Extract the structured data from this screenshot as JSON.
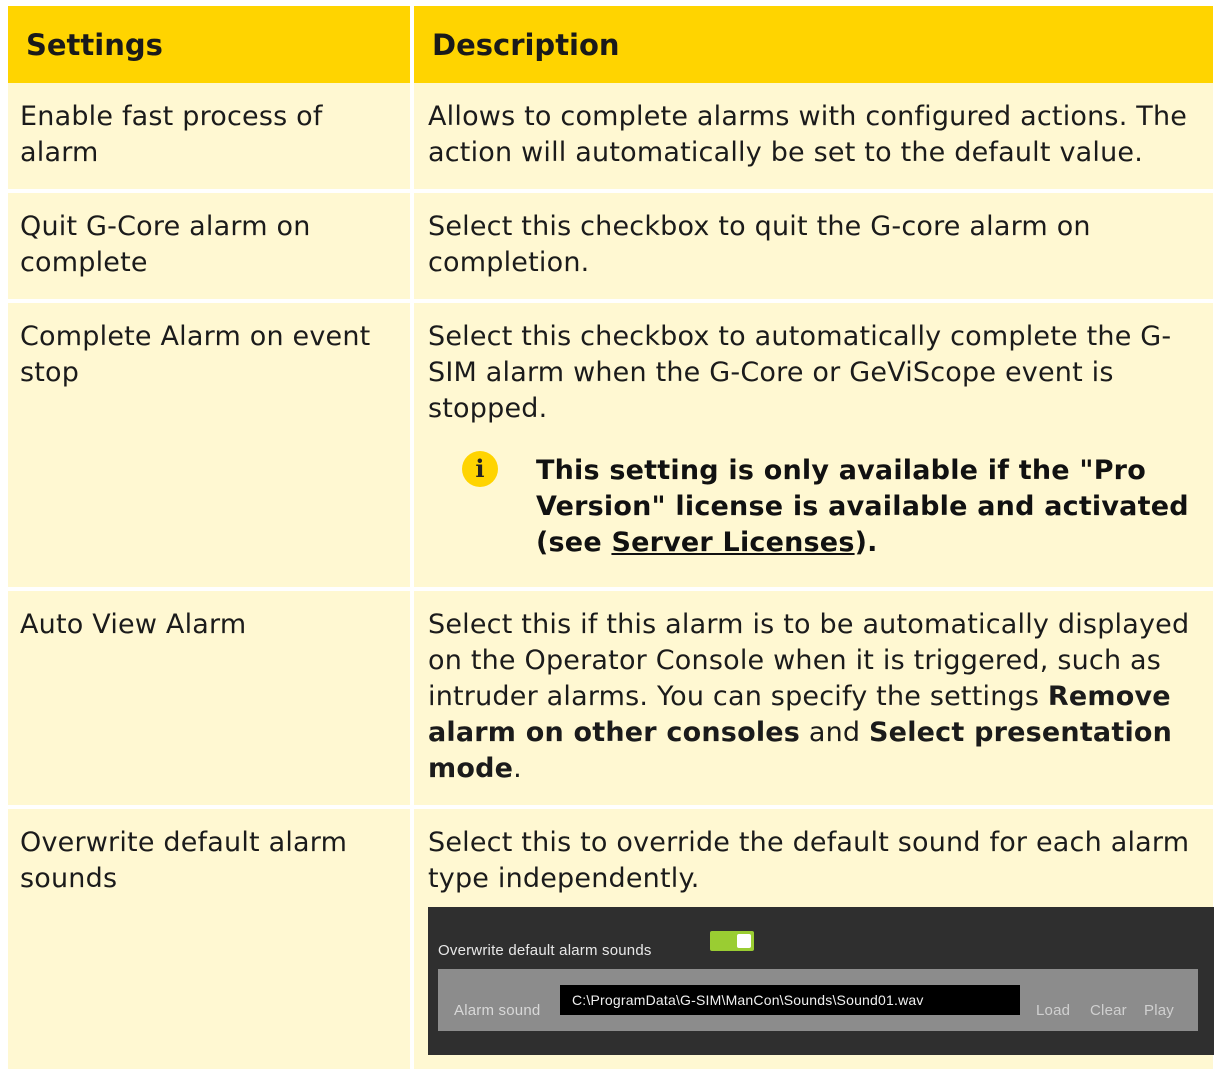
{
  "headers": {
    "settings": "Settings",
    "description": "Description"
  },
  "rows": [
    {
      "setting": "Enable fast process of alarm",
      "description": "Allows to complete alarms with configured actions. The action will automatically be set to the default value."
    },
    {
      "setting": "Quit G-Core alarm on complete",
      "description": "Select this checkbox to quit the G-core alarm on completion."
    },
    {
      "setting": "Complete Alarm on event stop",
      "description": "Select this checkbox to automatically complete the G-SIM alarm when the G-Core or GeViScope event is stopped.",
      "note": {
        "text_before": "This setting is only available if the \"Pro Version\" license is available and activ­ated (see ",
        "link": "Server Licenses",
        "text_after": ")."
      }
    },
    {
      "setting": "Auto View Alarm",
      "description_parts": {
        "text1": "Select this if this alarm is to be automatically dis­played on the Operator Console when it is triggered, such as intruder alarms. You can specify the settings ",
        "bold1": "Remove alarm on other consoles",
        "text2": " and ",
        "bold2": "Select presentation mode",
        "text3": "."
      }
    },
    {
      "setting": "Overwrite default alarm sounds",
      "description": "Select this to override the default sound for each alarm type independently.",
      "screenshot": {
        "toggle_label": "Overwrite default alarm sounds",
        "field_label": "Alarm sound",
        "path": "C:\\ProgramData\\G-SIM\\ManCon\\Sounds\\Sound01.wav",
        "buttons": [
          "Load",
          "Clear",
          "Play"
        ]
      }
    }
  ],
  "colors": {
    "header_bg": "#ffd400",
    "cell_bg": "#fff8d2",
    "toggle_on": "#9acd32"
  }
}
